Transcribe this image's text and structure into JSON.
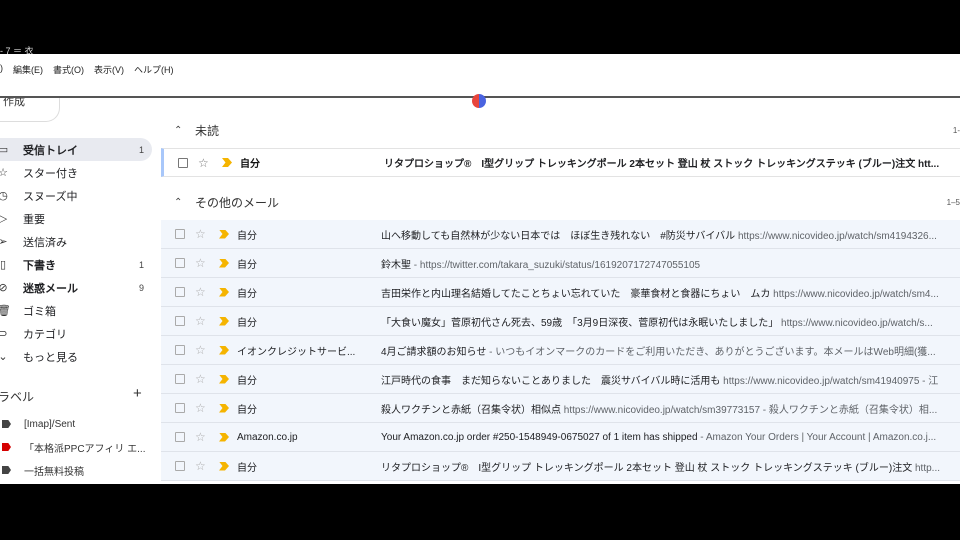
{
  "window": {
    "title_fragment": "- 7 ＝ 衣"
  },
  "menubar": {
    "leading": ")",
    "items": [
      "編集(E)",
      "書式(O)",
      "表示(V)",
      "ヘルプ(H)"
    ]
  },
  "compose": {
    "label": "作成",
    "icon": "pencil-icon"
  },
  "nav": {
    "items": [
      {
        "label": "受信トレイ",
        "count": "1",
        "icon": "inbox-icon"
      },
      {
        "label": "スター付き",
        "count": "",
        "icon": "star-icon"
      },
      {
        "label": "スヌーズ中",
        "count": "",
        "icon": "clock-icon"
      },
      {
        "label": "重要",
        "count": "",
        "icon": "important-icon"
      },
      {
        "label": "送信済み",
        "count": "",
        "icon": "send-icon"
      },
      {
        "label": "下書き",
        "count": "1",
        "icon": "draft-icon"
      },
      {
        "label": "迷惑メール",
        "count": "9",
        "icon": "spam-icon"
      },
      {
        "label": "ゴミ箱",
        "count": "",
        "icon": "trash-icon"
      },
      {
        "label": "カテゴリ",
        "count": "",
        "icon": "label-icon"
      },
      {
        "label": "もっと見る",
        "count": "",
        "icon": "chevron-down-icon"
      }
    ]
  },
  "labels": {
    "heading": "ラベル",
    "add": "+",
    "items": [
      {
        "label": "[Imap]/Sent",
        "color": "#444444"
      },
      {
        "label": "「本格派PPCアフィリ エ...",
        "color": "#d50000"
      },
      {
        "label": "一括無料投稿",
        "color": "#444444"
      }
    ]
  },
  "sections": {
    "unread": {
      "title": "未読",
      "range": "1-"
    },
    "other": {
      "title": "その他のメール",
      "range": "1–5"
    }
  },
  "unread_rows": [
    {
      "sender": "自分",
      "subject": "リタプロショップ®　I型グリップ トレッキングポール 2本セット 登山 杖 ストック トレッキングステッキ (ブルー)注文 htt...",
      "snippet": ""
    }
  ],
  "other_rows": [
    {
      "sender": "自分",
      "subject": "山へ移動しても自然林が少ない日本では　ほぼ生き残れない　#防災サバイバル",
      "snippet": " https://www.nicovideo.jp/watch/sm4194326..."
    },
    {
      "sender": "自分",
      "subject": "鈴木聖",
      "snippet": " - https://twitter.com/takara_suzuki/status/1619207172747055105"
    },
    {
      "sender": "自分",
      "subject": "吉田栄作と内山理名結婚してたことちょい忘れていた　豪華食材と食器にちょい　ムカ",
      "snippet": " https://www.nicovideo.jp/watch/sm4..."
    },
    {
      "sender": "自分",
      "subject": "「大食い魔女」菅原初代さん死去、59歳　「3月9日深夜、菅原初代は永眠いたしました」",
      "snippet": " https://www.nicovideo.jp/watch/s..."
    },
    {
      "sender": "イオンクレジットサービ...",
      "subject": "4月ご請求額のお知らせ",
      "snippet": " - いつもイオンマークのカードをご利用いただき、ありがとうございます。本メールはWeb明細(獲..."
    },
    {
      "sender": "自分",
      "subject": "江戸時代の食事　まだ知らないことありました　震災サバイバル時に活用も",
      "snippet": " https://www.nicovideo.jp/watch/sm41940975 - 江"
    },
    {
      "sender": "自分",
      "subject": "殺人ワクチンと赤紙（召集令状）相似点",
      "snippet": " https://www.nicovideo.jp/watch/sm39773157 - 殺人ワクチンと赤紙（召集令状）相..."
    },
    {
      "sender": "Amazon.co.jp",
      "subject": "Your Amazon.co.jp order #250-1548949-0675027 of 1 item has shipped",
      "snippet": " - Amazon Your Orders | Your Account | Amazon.co.j..."
    },
    {
      "sender": "自分",
      "subject": "リタプロショップ®　I型グリップ トレッキングポール 2本セット 登山 杖 ストック トレッキングステッキ (ブルー)注文",
      "snippet": " http..."
    }
  ]
}
